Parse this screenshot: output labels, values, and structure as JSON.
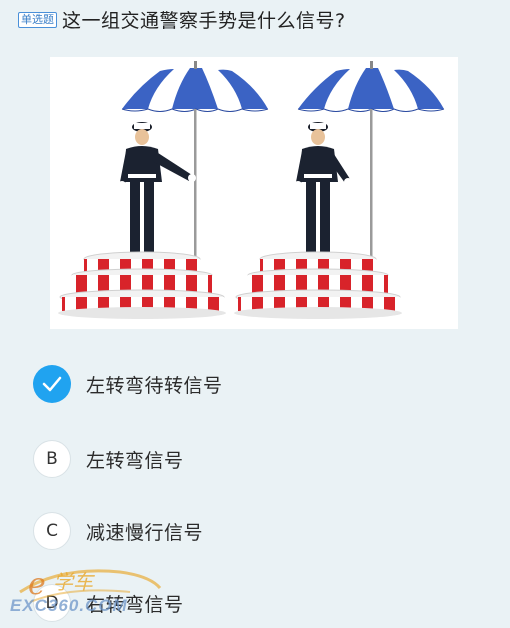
{
  "question": {
    "type_badge": "单选题",
    "text": "这一组交通警察手势是什么信号?"
  },
  "figure": {
    "umbrella_colors": {
      "primary": "#3b63c4",
      "secondary": "#ffffff"
    },
    "platform_colors": {
      "stripe": "#d8232a",
      "base": "#ffffff"
    }
  },
  "options": [
    {
      "marker": "✓",
      "label": "左转弯待转信号",
      "state": "selected"
    },
    {
      "marker": "B",
      "label": "左转弯信号",
      "state": "plain"
    },
    {
      "marker": "C",
      "label": "减速慢行信号",
      "state": "plain"
    },
    {
      "marker": "D",
      "label": "右转弯信号",
      "state": "plain"
    }
  ],
  "watermark": {
    "logo_text": "学车",
    "site": "EXC360.COM"
  },
  "accent_color": "#20a3f0"
}
